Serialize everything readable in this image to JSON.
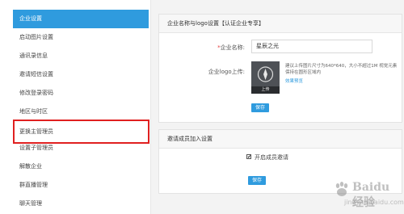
{
  "sidebar": {
    "items": [
      {
        "label": "企业设置",
        "active": true
      },
      {
        "label": "启动图片设置"
      },
      {
        "label": "通讯录信息"
      },
      {
        "label": "邀请短信设置"
      },
      {
        "label": "修改登录密码"
      },
      {
        "label": "地区与时区"
      },
      {
        "label": "更换主管理员"
      },
      {
        "label": "设置子管理员"
      },
      {
        "label": "解散企业"
      },
      {
        "label": "群直播管理"
      },
      {
        "label": "聊天管理"
      }
    ]
  },
  "panel_name_logo": {
    "title": "企业名称与logo设置【认证企业专享】",
    "name_label": "企业名称:",
    "name_required_mark": "*",
    "name_value": "星辰之光",
    "logo_label": "企业logo上传:",
    "logo_caption": "上传",
    "hint": "建议上传图片尺寸为640*640，大小不超过1M 视觉元素保持在圆形区域内",
    "preview_link": "效果预览",
    "save_label": "保存"
  },
  "panel_invite": {
    "title": "邀请成员加入设置",
    "checkbox_label": "开启成员邀请",
    "checkbox_checked": true,
    "save_label": "保存"
  },
  "watermark": {
    "brand": "Baidu经验",
    "url": "jingyan.baidu.com"
  },
  "colors": {
    "accent": "#2f9bde",
    "highlight": "#e02020"
  }
}
